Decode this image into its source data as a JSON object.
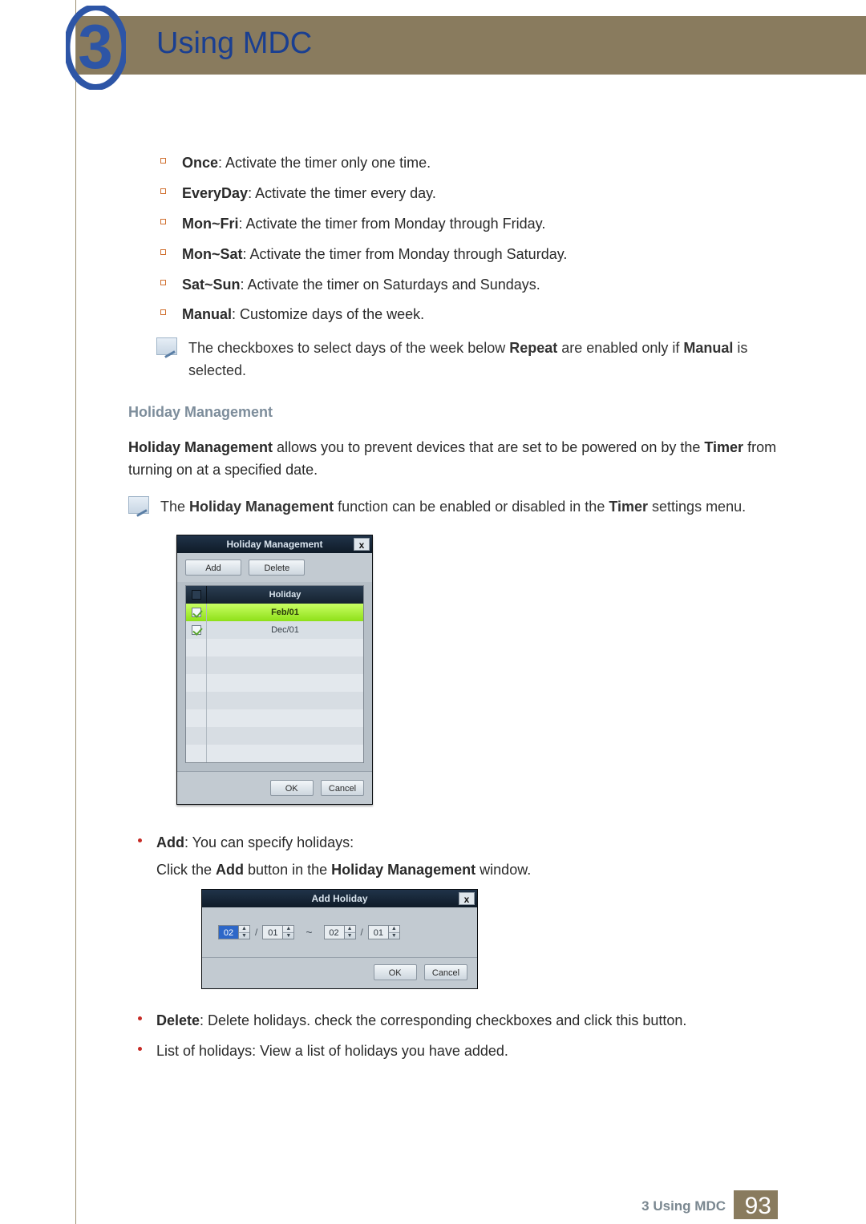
{
  "chapter": {
    "number": "3",
    "title": "Using MDC"
  },
  "repeat_options": [
    {
      "label": "Once",
      "desc": ": Activate the timer only one time."
    },
    {
      "label": "EveryDay",
      "desc": ": Activate the timer every day."
    },
    {
      "label": "Mon~Fri",
      "desc": ": Activate the timer from Monday through Friday."
    },
    {
      "label": "Mon~Sat",
      "desc": ": Activate the timer from Monday through Saturday."
    },
    {
      "label": "Sat~Sun",
      "desc": ": Activate the timer on Saturdays and Sundays."
    },
    {
      "label": "Manual",
      "desc": ": Customize days of the week."
    }
  ],
  "note1": {
    "pre": "The checkboxes to select days of the week below ",
    "b1": "Repeat",
    "mid": " are enabled only if ",
    "b2": "Manual",
    "post": " is selected."
  },
  "section_heading": "Holiday Management",
  "intro": {
    "b1": "Holiday Management",
    "mid": " allows you to prevent devices that are set to be powered on by the ",
    "b2": "Timer",
    "post": " from turning on at a specified date."
  },
  "note2": {
    "pre": "The ",
    "b1": "Holiday Management",
    "mid": " function can be enabled or disabled in the ",
    "b2": "Timer",
    "post": " settings menu."
  },
  "hm_dialog": {
    "title": "Holiday Management",
    "close": "x",
    "add_btn": "Add",
    "delete_btn": "Delete",
    "col_header": "Holiday",
    "rows": [
      {
        "checked": true,
        "value": "Feb/01",
        "selected": true
      },
      {
        "checked": true,
        "value": "Dec/01",
        "selected": false
      }
    ],
    "ok": "OK",
    "cancel": "Cancel"
  },
  "bullets": {
    "add_label": "Add",
    "add_desc": ": You can specify holidays:",
    "add_sub_pre": "Click the ",
    "add_sub_b1": "Add",
    "add_sub_mid": " button in the ",
    "add_sub_b2": "Holiday Management",
    "add_sub_post": " window.",
    "delete_label": "Delete",
    "delete_desc": ": Delete holidays. check the corresponding checkboxes and click this button.",
    "list_desc": "List of holidays: View a list of holidays you have added."
  },
  "ah_dialog": {
    "title": "Add Holiday",
    "close": "x",
    "from_month": "02",
    "from_day": "01",
    "to_month": "02",
    "to_day": "01",
    "sep": "/",
    "range": "~",
    "ok": "OK",
    "cancel": "Cancel"
  },
  "footer": {
    "label": "3 Using MDC",
    "page": "93"
  }
}
